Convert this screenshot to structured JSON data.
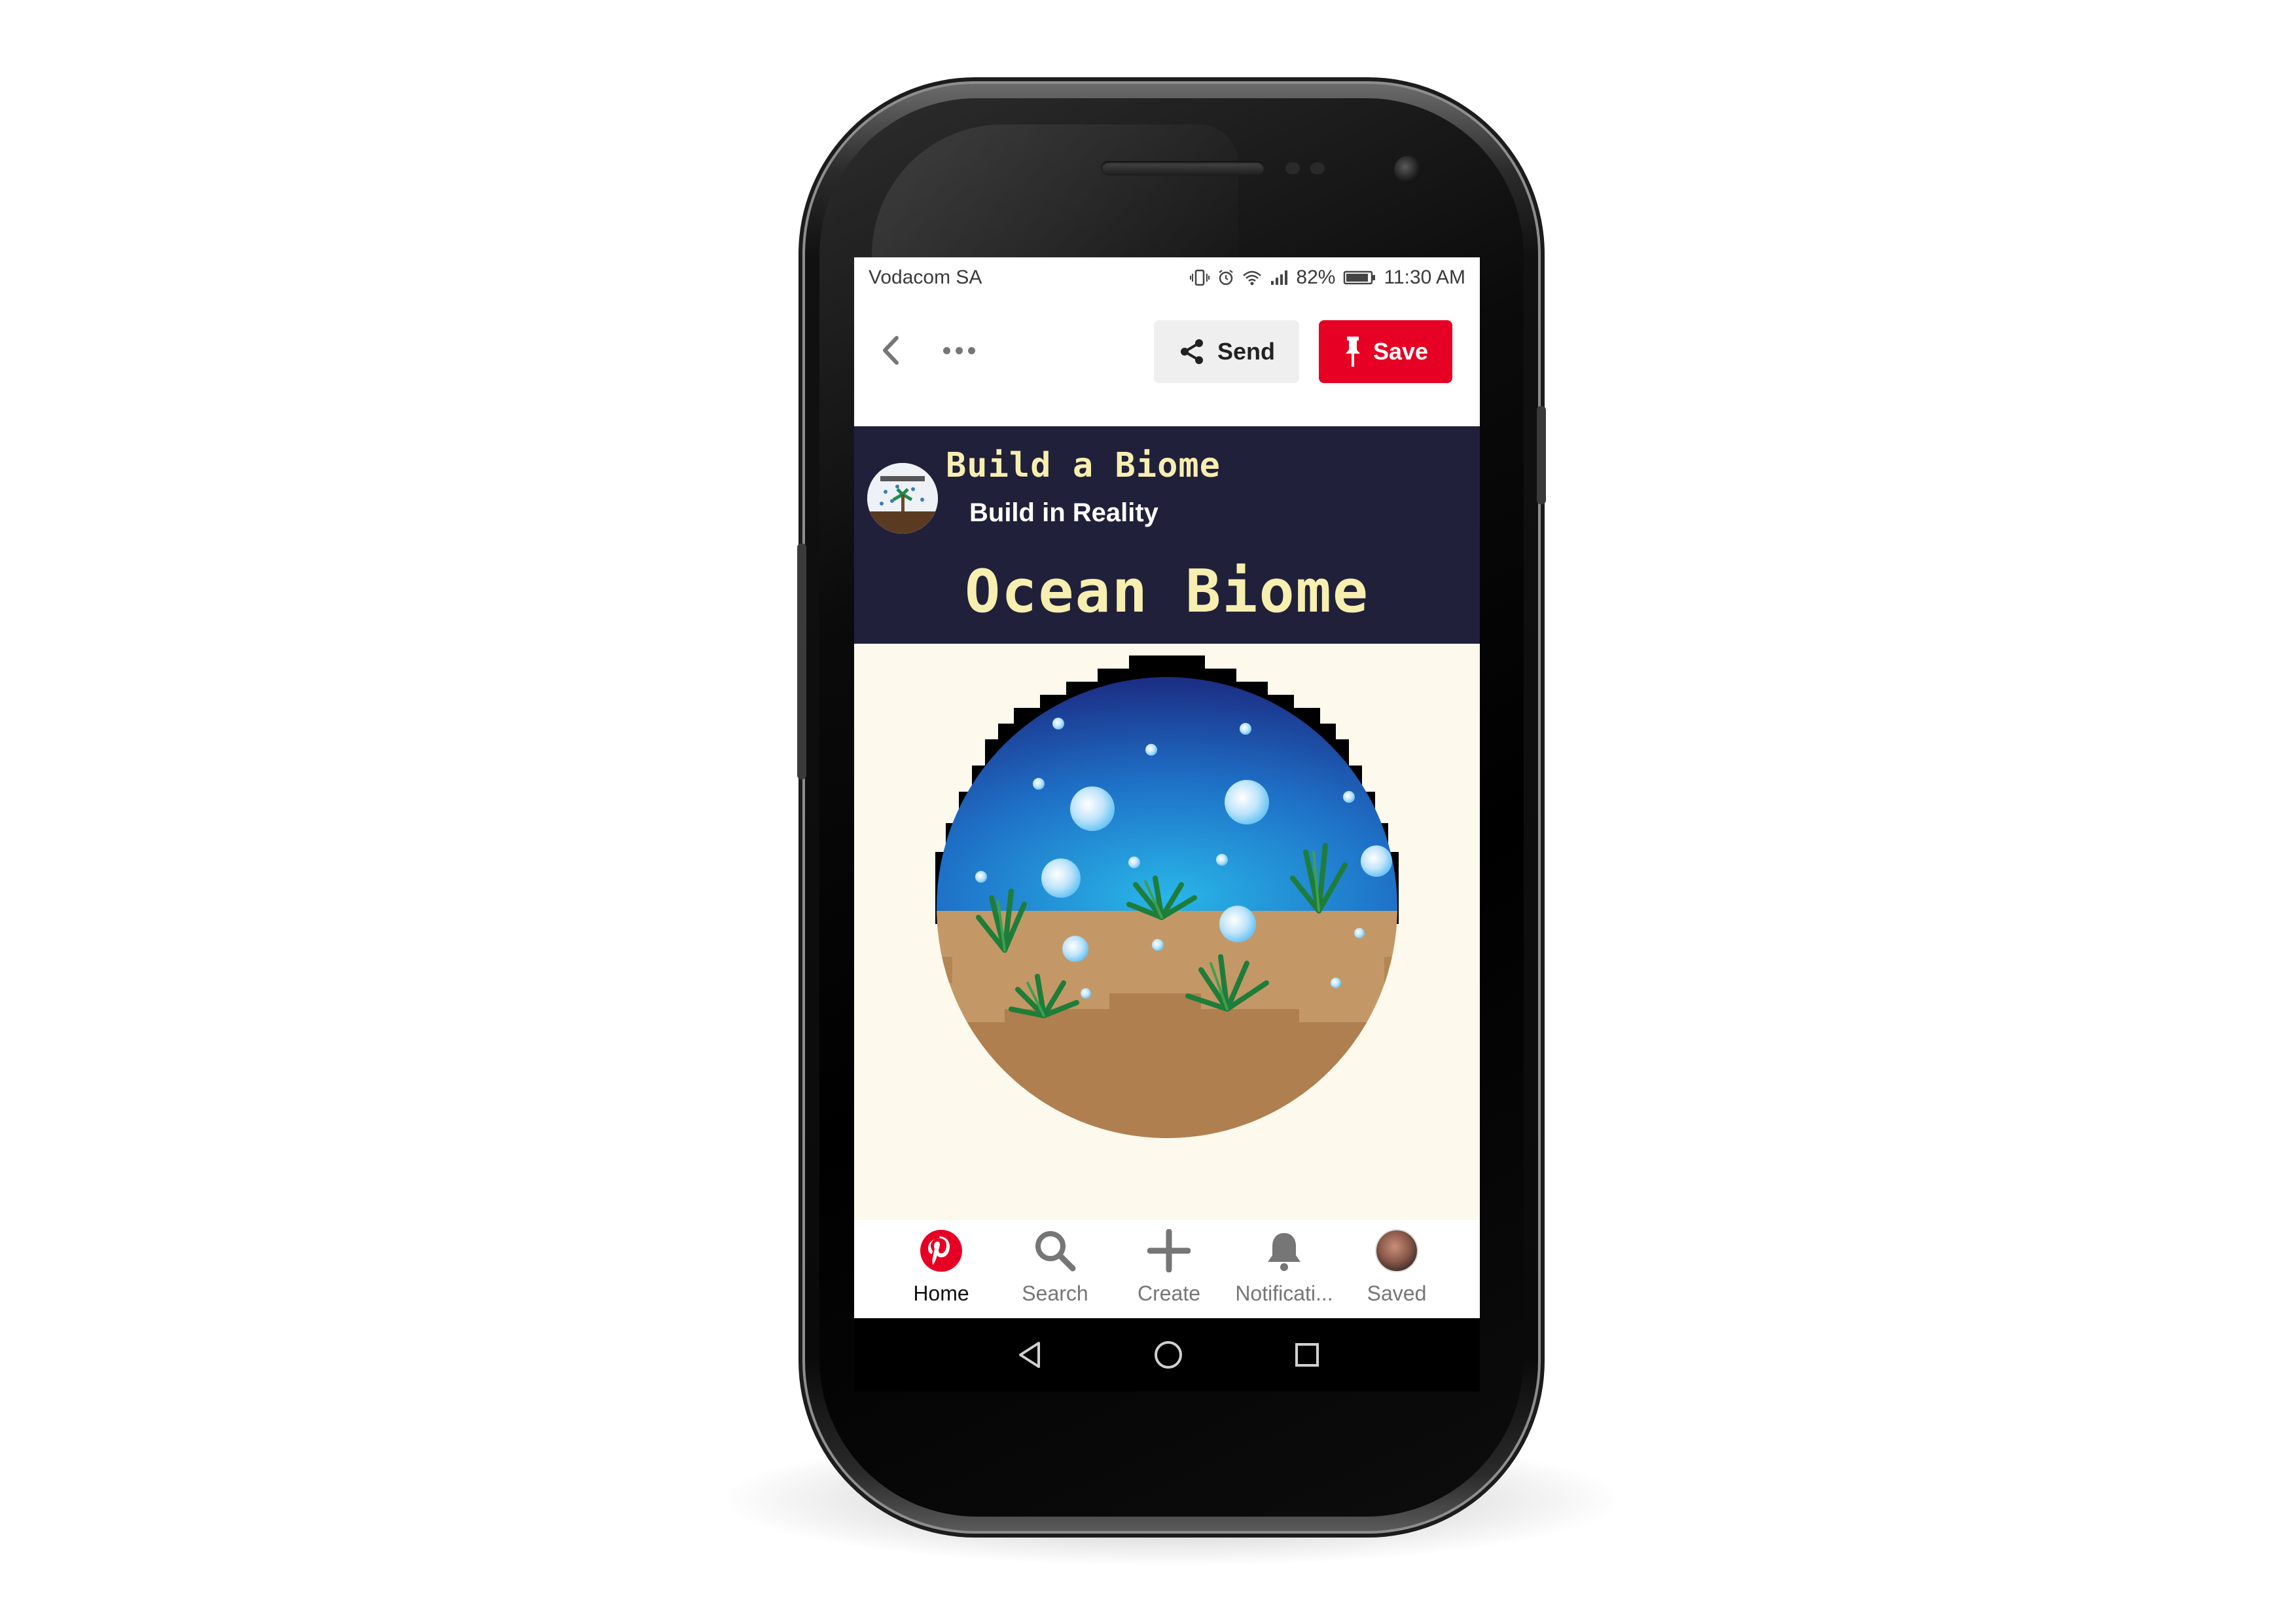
{
  "status_bar": {
    "carrier": "Vodacom SA",
    "battery": "82%",
    "time": "11:30 AM",
    "icons": [
      "vibrate-icon",
      "alarm-icon",
      "wifi-icon",
      "signal-icon",
      "battery-icon"
    ]
  },
  "action_bar": {
    "back_icon": "chevron-left-icon",
    "more_icon": "more-horizontal-icon",
    "send_label": "Send",
    "save_label": "Save",
    "save_color": "#e60023"
  },
  "pin": {
    "brand_name": "Build a Biome",
    "brand_tagline": "Build in Reality",
    "title": "Ocean Biome",
    "header_bg": "#21203a",
    "title_color": "#f7efb0",
    "image_bg": "#fdf9ed"
  },
  "tabs": [
    {
      "label": "Home",
      "icon": "pinterest-logo-icon",
      "active": true
    },
    {
      "label": "Search",
      "icon": "search-icon",
      "active": false
    },
    {
      "label": "Create",
      "icon": "plus-icon",
      "active": false
    },
    {
      "label": "Notificati...",
      "icon": "bell-icon",
      "active": false
    },
    {
      "label": "Saved",
      "icon": "avatar",
      "active": false
    }
  ],
  "nav": [
    "back-triangle-icon",
    "home-circle-icon",
    "recents-square-icon"
  ]
}
